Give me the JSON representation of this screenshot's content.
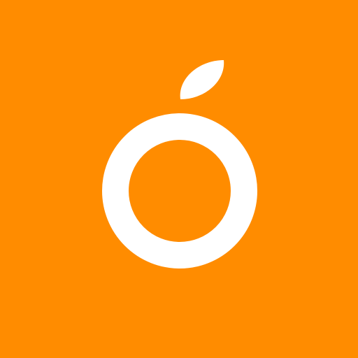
{
  "icon": {
    "name": "orange-fruit-logo",
    "background_color": "#FF8C00",
    "glyph_color": "#FFFFFF"
  }
}
